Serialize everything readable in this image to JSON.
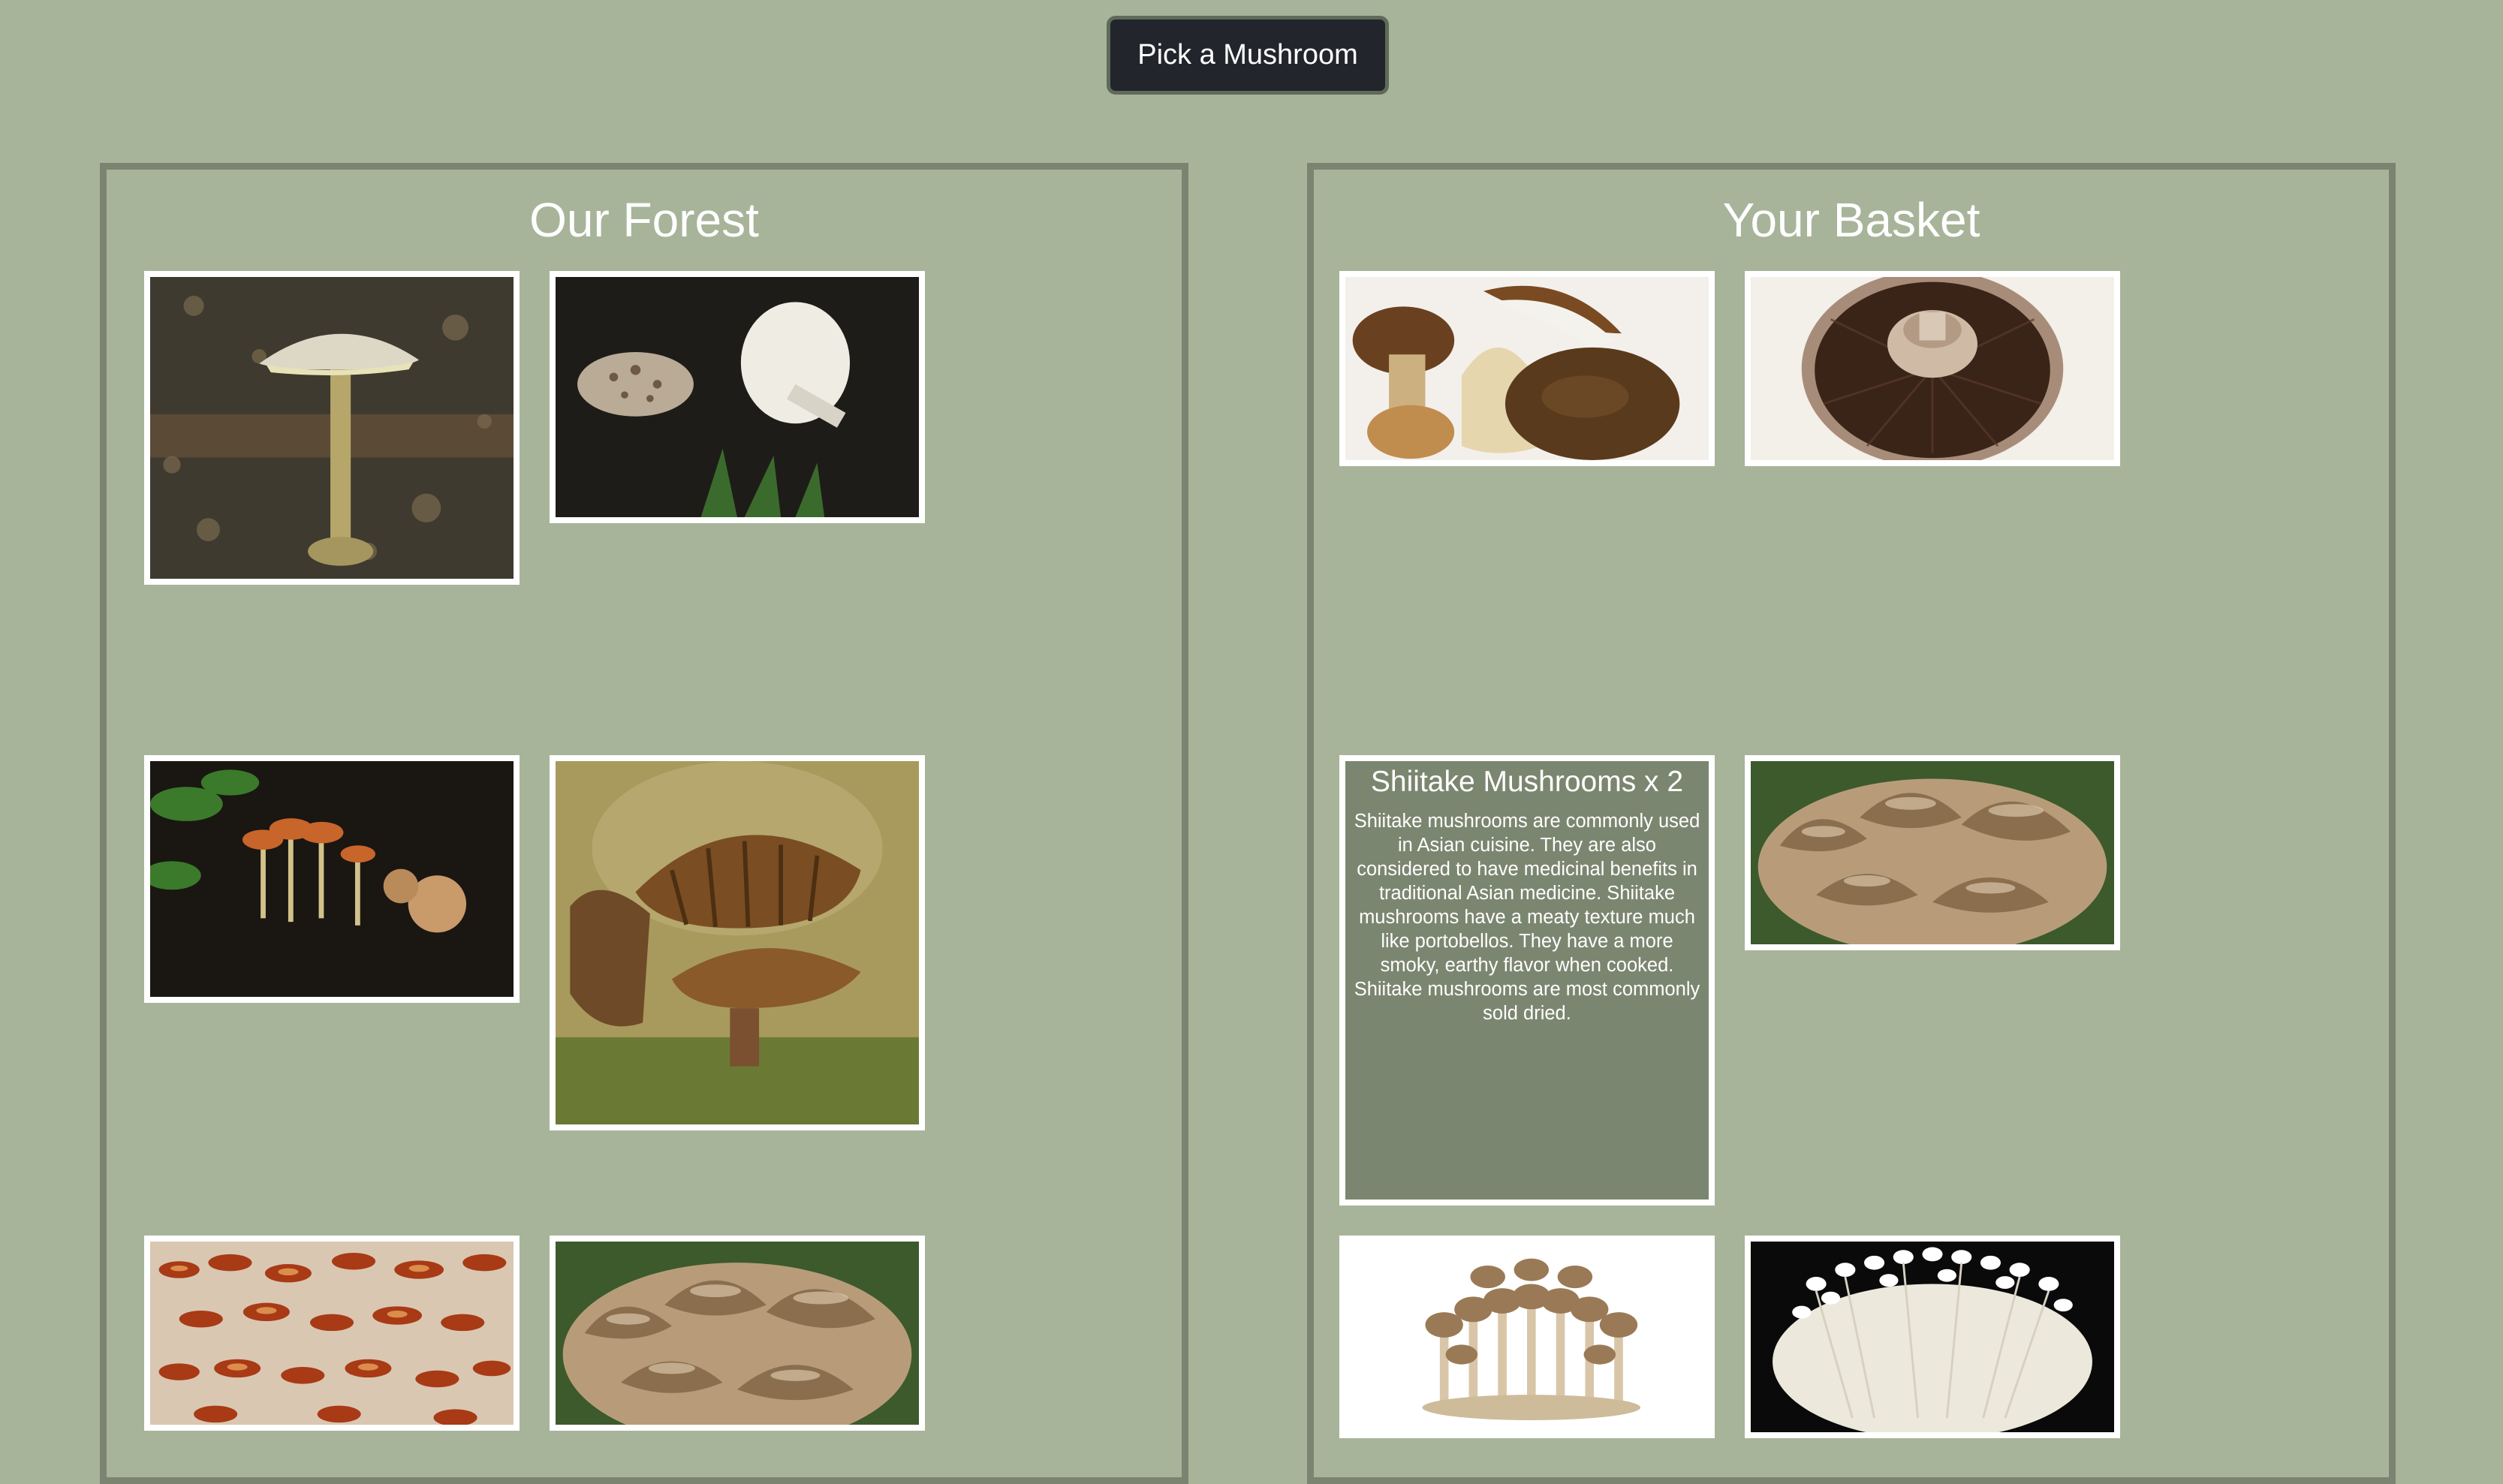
{
  "header": {
    "pick_button_label": "Pick a Mushroom"
  },
  "forest": {
    "title": "Our Forest",
    "items": [
      {
        "icon": "amanita-mushroom-photo"
      },
      {
        "icon": "parasol-mushrooms-photo"
      },
      {
        "icon": "orange-cluster-mushrooms-photo"
      },
      {
        "icon": "brown-gilled-mushroom-photo"
      },
      {
        "icon": "reishi-shelf-mushrooms-photo"
      },
      {
        "icon": "maitake-mushroom-photo"
      }
    ]
  },
  "basket": {
    "title": "Your Basket",
    "items": [
      {
        "icon": "porcini-mushrooms-photo"
      },
      {
        "icon": "portobello-underside-photo"
      },
      {
        "title": "Shiitake Mushrooms x 2",
        "description": "Shiitake mushrooms are commonly used in Asian cuisine. They are also considered to have medicinal benefits in traditional Asian medicine. Shiitake mushrooms have a meaty texture much like portobellos. They have a more smoky, earthy flavor when cooked. Shiitake mushrooms are most commonly sold dried."
      },
      {
        "icon": "maitake-mushroom-photo"
      },
      {
        "icon": "beech-mushroom-cluster-photo"
      },
      {
        "icon": "enoki-mushrooms-photo"
      }
    ]
  },
  "colors": {
    "background": "#a7b49a",
    "panel_border": "#7b8470",
    "info_card": "#7b8670",
    "button": "#22252b"
  }
}
